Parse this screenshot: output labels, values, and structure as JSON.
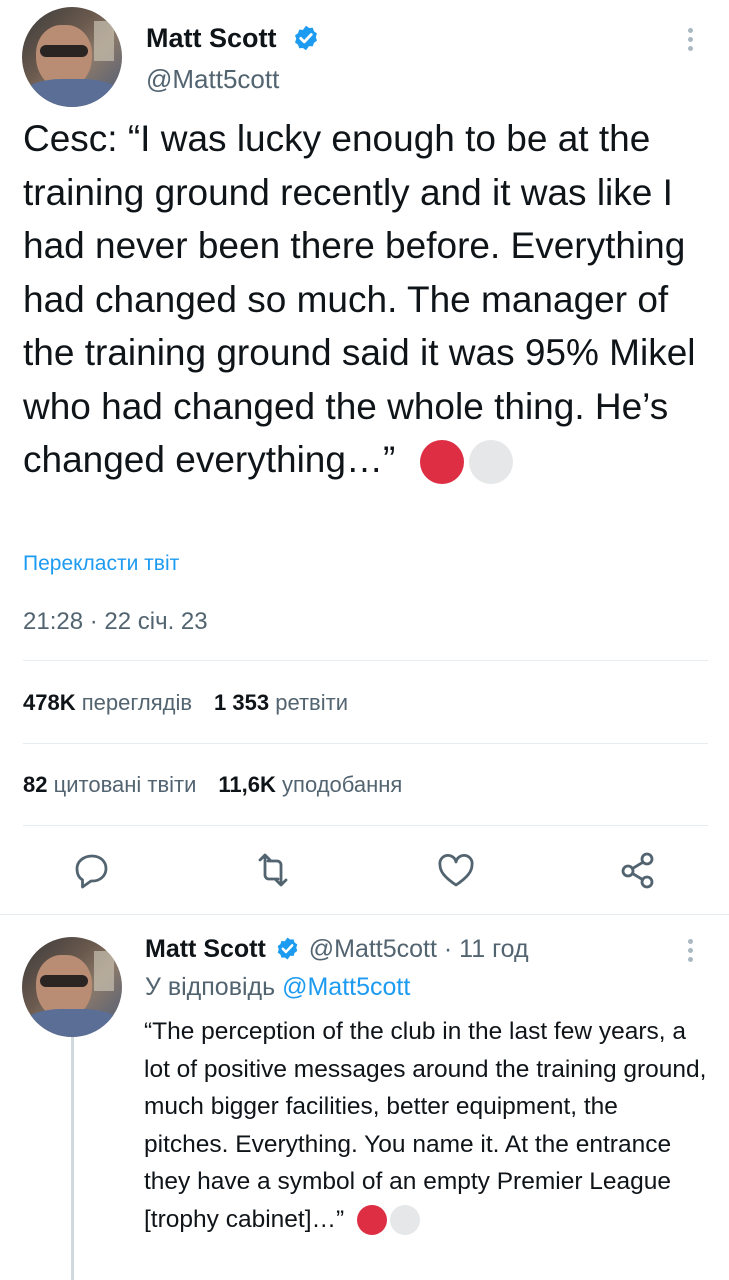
{
  "tweet": {
    "author_name": "Matt Scott",
    "author_handle": "@Matt5cott",
    "text": "Cesc: “I was lucky enough to be at the training ground recently and it was like I had never been there before. Everything had changed so much. The manager of the training ground said it was 95% Mikel who had changed the whole thing. He’s changed everything…”",
    "emoji": [
      "red-circle",
      "white-circle"
    ],
    "translate_label": "Перекласти твіт",
    "timestamp": "21:28 · 22 січ. 23",
    "stats": {
      "views_count": "478K",
      "views_label": "переглядів",
      "retweets_count": "1 353",
      "retweets_label": "ретвіти",
      "quotes_count": "82",
      "quotes_label": "цитовані твіти",
      "likes_count": "11,6K",
      "likes_label": "уподобання"
    },
    "actions": [
      "reply-icon",
      "retweet-icon",
      "like-icon",
      "share-icon"
    ]
  },
  "reply": {
    "author_name": "Matt Scott",
    "author_handle": "@Matt5cott",
    "separator": "·",
    "time_ago": "11 год",
    "reply_prefix": "У відповідь",
    "reply_to_handle": "@Matt5cott",
    "text": "“The perception of the club in the last few years, a lot of positive messages around the training ground, much bigger facilities, better equipment, the pitches. Everything. You name it. At the entrance they have a symbol of an empty Premier League [trophy cabinet]…”",
    "emoji": [
      "red-circle",
      "white-circle"
    ]
  },
  "colors": {
    "accent": "#1d9bf0",
    "verified": "#1d9bf0",
    "red_circle": "#dd2e44",
    "white_circle": "#e6e7e8",
    "secondary_text": "#536471"
  }
}
